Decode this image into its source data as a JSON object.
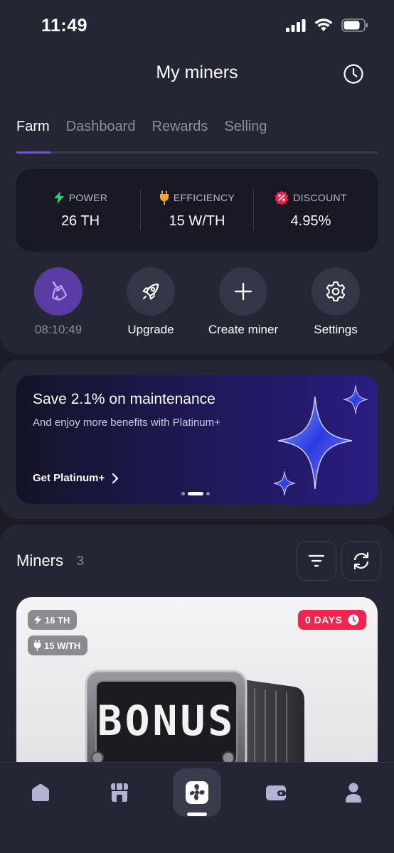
{
  "status_bar": {
    "time": "11:49"
  },
  "header": {
    "title": "My miners",
    "history_icon": "clock-icon"
  },
  "tabs": [
    {
      "label": "Farm",
      "active": true
    },
    {
      "label": "Dashboard",
      "active": false
    },
    {
      "label": "Rewards",
      "active": false
    },
    {
      "label": "Selling",
      "active": false
    }
  ],
  "stats": {
    "power": {
      "label": "POWER",
      "value": "26 TH",
      "icon": "lightning-icon",
      "color": "#2ed47a"
    },
    "efficiency": {
      "label": "EFFICIENCY",
      "value": "15 W/TH",
      "icon": "plug-icon",
      "color": "#f5a623"
    },
    "discount": {
      "label": "DISCOUNT",
      "value": "4.95%",
      "icon": "discount-badge-icon",
      "color": "#f0244f"
    }
  },
  "actions": {
    "maintenance": {
      "label": "08:10:49",
      "icon": "broom-icon"
    },
    "upgrade": {
      "label": "Upgrade",
      "icon": "rocket-icon"
    },
    "create": {
      "label": "Create miner",
      "icon": "plus-icon"
    },
    "settings": {
      "label": "Settings",
      "icon": "gear-icon"
    }
  },
  "banner": {
    "title": "Save 2.1% on maintenance",
    "subtitle": "And enjoy more benefits with Platinum+",
    "link": "Get Platinum+",
    "slides": 3,
    "active_slide": 2
  },
  "miners": {
    "title": "Miners",
    "count": "3",
    "filter_icon": "filter-icon",
    "refresh_icon": "refresh-icon",
    "card": {
      "power": "16 TH",
      "efficiency": "15 W/TH",
      "days": "0 DAYS",
      "image_text": "BONUS"
    }
  },
  "bottom_nav": [
    {
      "icon": "home-icon"
    },
    {
      "icon": "store-icon"
    },
    {
      "icon": "fan-icon",
      "active": true
    },
    {
      "icon": "wallet-icon"
    },
    {
      "icon": "profile-icon"
    }
  ],
  "colors": {
    "accent": "#7c4dff",
    "background": "#1b1c26",
    "card": "#242633",
    "badge_red": "#f0244f"
  }
}
